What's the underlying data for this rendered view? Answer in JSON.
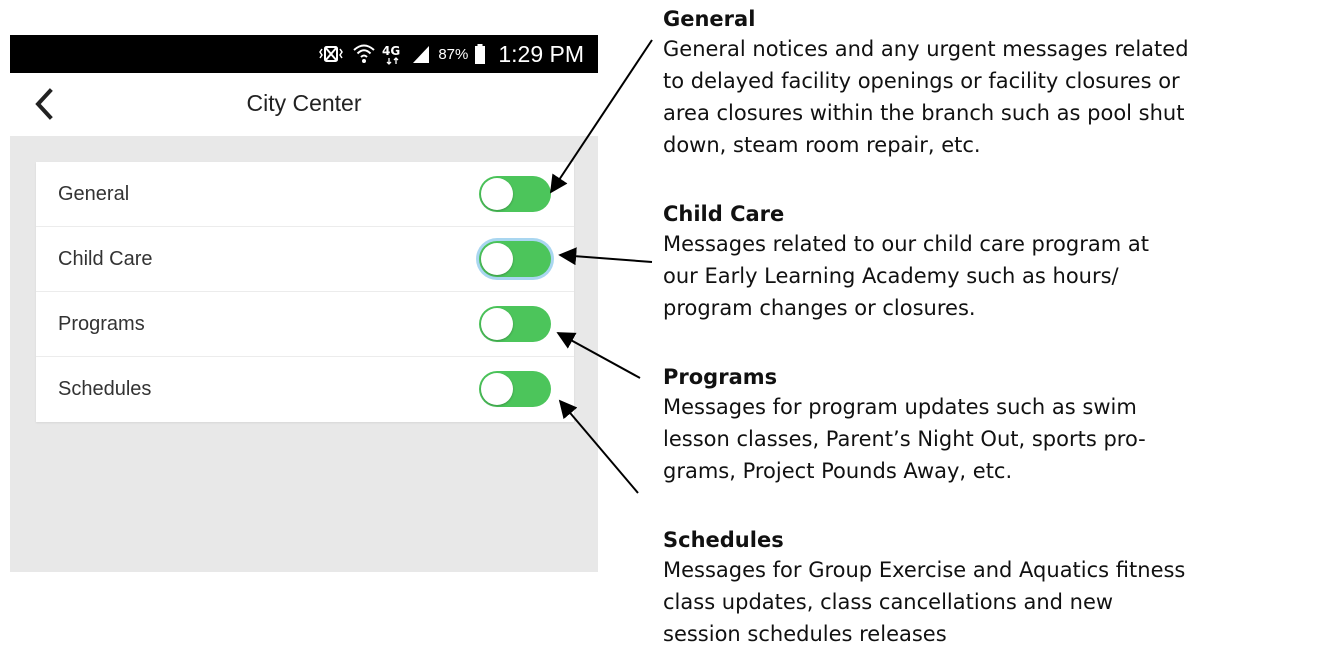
{
  "status_bar": {
    "battery_percent": "87%",
    "time": "1:29 PM",
    "icons": [
      "vibrate-icon",
      "wifi-icon",
      "4g-lte-icon",
      "signal-icon",
      "battery-icon"
    ]
  },
  "app_bar": {
    "title": "City Center",
    "back_icon": "chevron-left-icon"
  },
  "settings": [
    {
      "label": "General",
      "enabled": true
    },
    {
      "label": "Child Care",
      "enabled": true
    },
    {
      "label": "Programs",
      "enabled": true
    },
    {
      "label": "Schedules",
      "enabled": true
    }
  ],
  "colors": {
    "toggle_on": "#4cc55b",
    "content_bg": "#e8e8e8"
  },
  "annotations": [
    {
      "title": "General",
      "lines": [
        "General notices and any urgent messages related",
        "to delayed facility openings or facility closures or",
        "area closures within the branch such as pool shut",
        "down, steam room repair, etc."
      ]
    },
    {
      "title": "Child Care",
      "lines": [
        "Messages related to our child care program at",
        "our Early Learning Academy such as hours/",
        "program changes or closures."
      ]
    },
    {
      "title": "Programs",
      "lines": [
        "Messages for program updates such as swim",
        "lesson classes, Parent’s Night Out, sports pro-",
        "grams, Project Pounds Away, etc."
      ]
    },
    {
      "title": "Schedules",
      "lines": [
        "Messages for Group Exercise and Aquatics fitness",
        "class updates, class cancellations and new",
        "session schedules releases"
      ]
    }
  ]
}
